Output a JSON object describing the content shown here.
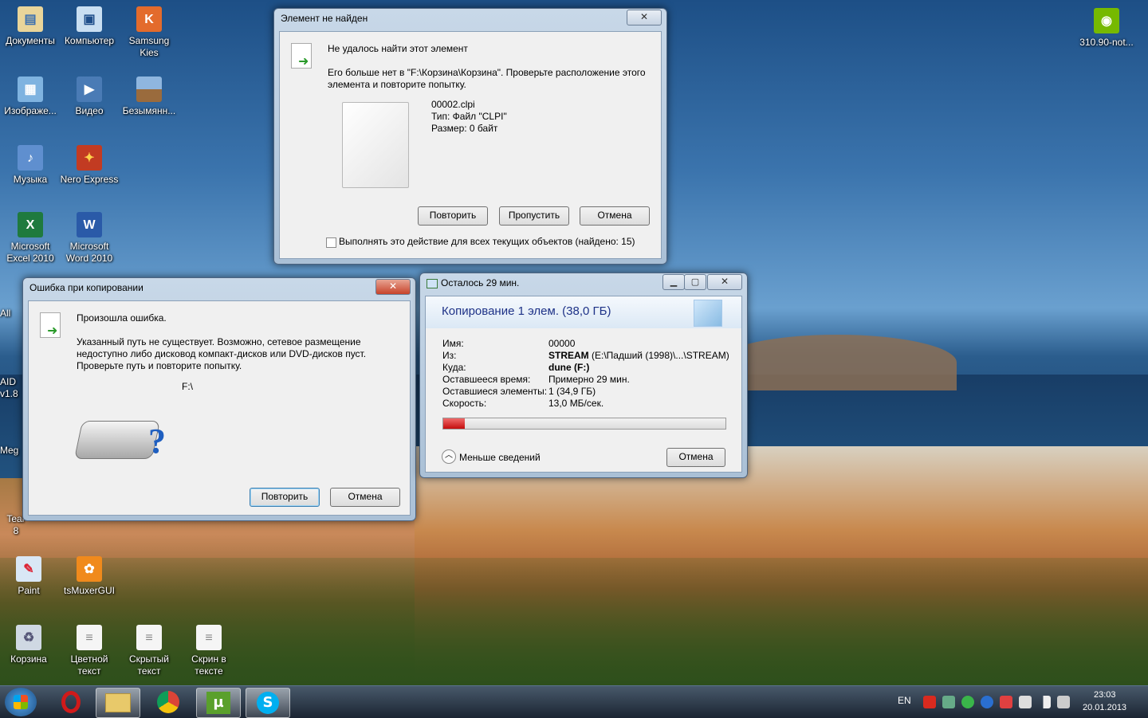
{
  "desktop_icons": [
    {
      "label": "Документы"
    },
    {
      "label": "Компьютер"
    },
    {
      "label": "Samsung Kies"
    },
    {
      "label": "Изображе..."
    },
    {
      "label": "Видео"
    },
    {
      "label": "Безымянн..."
    },
    {
      "label": "Музыка"
    },
    {
      "label": "Nero Express"
    },
    {
      "label": "Microsoft Excel 2010"
    },
    {
      "label": "Microsoft Word 2010"
    },
    {
      "label": "All"
    },
    {
      "label": "AID"
    },
    {
      "label": "v1.8"
    },
    {
      "label": "Meg"
    },
    {
      "label": "Tear"
    },
    {
      "label": "8"
    },
    {
      "label": "Paint"
    },
    {
      "label": "tsMuxerGUI"
    },
    {
      "label": "Корзина"
    },
    {
      "label": "Цветной текст"
    },
    {
      "label": "Скрытый текст"
    },
    {
      "label": "Скрин в тексте"
    },
    {
      "label": "310.90-not..."
    }
  ],
  "dialog_not_found": {
    "title": "Элемент не найден",
    "heading": "Не удалось найти этот элемент",
    "message_line1": "Его больше нет в \"F:\\Корзина\\Корзина\". Проверьте расположение этого",
    "message_line2": "элемента и повторите попытку.",
    "file_name": "00002.clpi",
    "file_type": "Тип: Файл \"CLPI\"",
    "file_size": "Размер: 0 байт",
    "retry": "Повторить",
    "skip": "Пропустить",
    "cancel": "Отмена",
    "checkbox_label": "Выполнять это действие для всех текущих объектов (найдено: 15)",
    "close": "✕"
  },
  "dialog_copy_error": {
    "title": "Ошибка при копировании",
    "heading": "Произошла ошибка.",
    "line1": "Указанный путь не существует. Возможно, сетевое размещение",
    "line2": "недоступно либо дисковод компакт-дисков или DVD-дисков пуст.",
    "line3": "Проверьте путь и повторите попытку.",
    "path": "F:\\",
    "retry": "Повторить",
    "cancel": "Отмена",
    "close": "✕"
  },
  "progress_window": {
    "title": "Осталось 29 мин.",
    "header": "Копирование 1 элем. (38,0 ГБ)",
    "rows": [
      {
        "label": "Имя:",
        "value": "00000"
      },
      {
        "label": "Из:",
        "value_bold": "STREAM",
        "value": " (E:\\Падший (1998)\\...\\STREAM)"
      },
      {
        "label": "Куда:",
        "value_bold": "dune (F:)",
        "value": ""
      },
      {
        "label": "Оставшееся время:",
        "value": "Примерно 29 мин."
      },
      {
        "label": "Оставшиеся элементы:",
        "value": "1 (34,9 ГБ)"
      },
      {
        "label": "Скорость:",
        "value": "13,0 МБ/сек."
      }
    ],
    "progress_fraction": 0.075,
    "less_details": "Меньше сведений",
    "cancel": "Отмена"
  },
  "taskbar": {
    "lang": "EN",
    "time": "23:03",
    "date": "20.01.2013"
  },
  "colors": {
    "progress_red": "#d0121a",
    "accent": "#3c7fb1"
  }
}
